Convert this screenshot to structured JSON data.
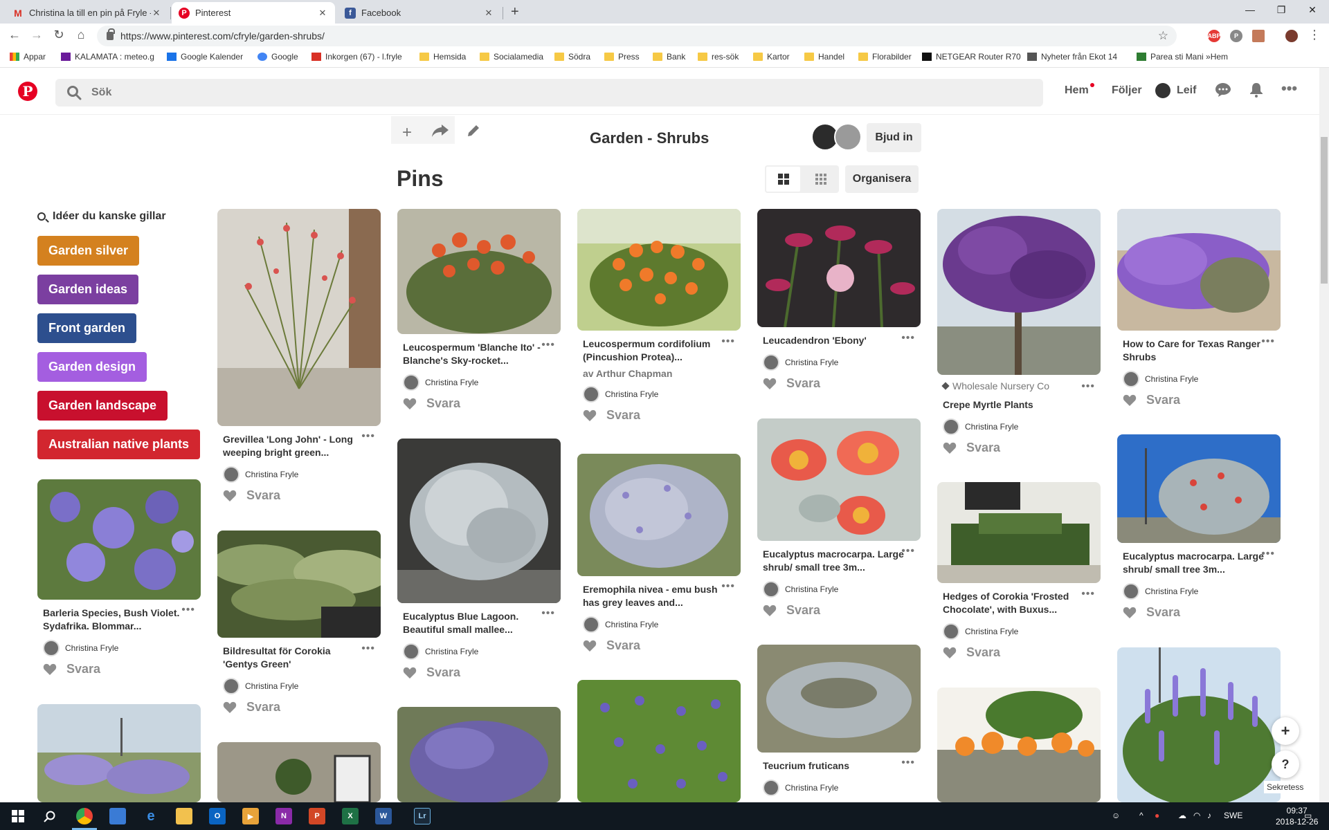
{
  "browser": {
    "tabs": [
      {
        "label": "Christina la till en pin på Fryle - L",
        "icon": "gmail-icon"
      },
      {
        "label": "Pinterest",
        "icon": "pinterest-icon"
      },
      {
        "label": "Facebook",
        "icon": "facebook-icon"
      }
    ],
    "url": "https://www.pinterest.com/cfryle/garden-shrubs/",
    "bookmarks": [
      "Appar",
      "KALAMATA : meteo.g",
      "Google Kalender",
      "Google",
      "Inkorgen (67) - l.fryle",
      "Hemsida",
      "Socialamedia",
      "Södra",
      "Press",
      "Bank",
      "res-sök",
      "Kartor",
      "Handel",
      "Florabilder",
      "NETGEAR Router R70",
      "Nyheter från Ekot 14",
      "Parea sti Mani »Hem"
    ]
  },
  "header": {
    "search_placeholder": "Sök",
    "home": "Hem",
    "following": "Följer",
    "user": "Leif"
  },
  "board": {
    "title": "Garden - Shrubs",
    "invite": "Bjud in",
    "pins_heading": "Pins",
    "organise": "Organisera"
  },
  "ideas": {
    "heading": "Idéer du kanske gillar",
    "chips": [
      {
        "label": "Garden silver",
        "color": "#d4811f"
      },
      {
        "label": "Garden ideas",
        "color": "#7b3fa0"
      },
      {
        "label": "Front garden",
        "color": "#2d4f8e"
      },
      {
        "label": "Garden design",
        "color": "#a45ee0"
      },
      {
        "label": "Garden landscape",
        "color": "#c8102e"
      },
      {
        "label": "Australian native plants",
        "color": "#d2262f"
      }
    ]
  },
  "pins": [
    {
      "title": "Barleria Species, Bush Violet. Sydafrika. Blommar...",
      "owner": "Christina Fryle",
      "reply": "Svara"
    },
    {
      "title": "Grevillea 'Long John' - Long weeping bright green...",
      "owner": "Christina Fryle",
      "reply": "Svara"
    },
    {
      "title": "Bildresultat för Corokia 'Gentys Green'",
      "owner": "Christina Fryle",
      "reply": "Svara"
    },
    {
      "title": "Leucospermum 'Blanche Ito' - Blanche's Sky-rocket...",
      "owner": "Christina Fryle",
      "reply": "Svara"
    },
    {
      "title": "Eucalyptus Blue Lagoon. Beautiful small mallee...",
      "owner": "Christina Fryle",
      "reply": "Svara"
    },
    {
      "title": "Leucospermum cordifolium (Pincushion Protea)...",
      "source": "av Arthur Chapman",
      "owner": "Christina Fryle",
      "reply": "Svara"
    },
    {
      "title": "Eremophila nivea - emu bush has grey leaves and...",
      "owner": "Christina Fryle",
      "reply": "Svara"
    },
    {
      "title": "Leucadendron 'Ebony'",
      "owner": "Christina Fryle",
      "reply": "Svara"
    },
    {
      "title": "Eucalyptus macrocarpa. Large shrub/ small tree 3m...",
      "owner": "Christina Fryle",
      "reply": "Svara"
    },
    {
      "title": "Teucrium fruticans",
      "owner": "Christina Fryle"
    },
    {
      "title": "Crepe Myrtle Plants",
      "source": "Wholesale Nursery Co",
      "owner": "Christina Fryle",
      "reply": "Svara"
    },
    {
      "title": "Hedges of Corokia 'Frosted Chocolate', with Buxus...",
      "owner": "Christina Fryle",
      "reply": "Svara"
    },
    {
      "title": "How to Care for Texas Ranger Shrubs",
      "owner": "Christina Fryle",
      "reply": "Svara"
    },
    {
      "title": "Eucalyptus macrocarpa. Large shrub/ small tree 3m...",
      "owner": "Christina Fryle",
      "reply": "Svara"
    }
  ],
  "floating": {
    "add": "+",
    "help": "?",
    "privacy": "Sekretess"
  },
  "taskbar": {
    "lang": "SWE",
    "time": "09:37",
    "date": "2018-12-26"
  }
}
